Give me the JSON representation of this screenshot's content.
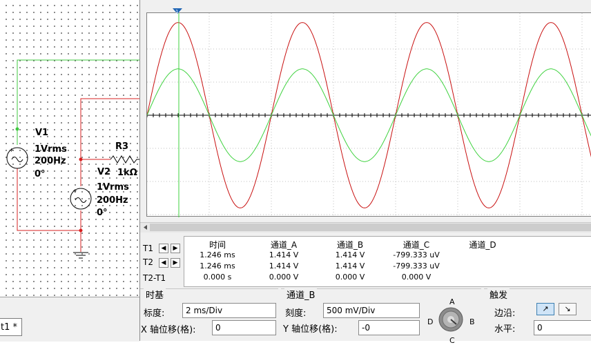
{
  "schematic": {
    "v1": {
      "name": "V1",
      "amplitude": "1Vrms",
      "frequency": "200Hz",
      "phase": "0°"
    },
    "v2": {
      "name": "V2",
      "amplitude": "1Vrms",
      "frequency": "200Hz",
      "phase": "0°"
    },
    "r3": {
      "name": "R3",
      "value": "1kΩ"
    },
    "sheet_tab": "t1 *",
    "colors": {
      "wire_a": "#3fc83f",
      "wire_b": "#d72020"
    }
  },
  "scope": {
    "trace_colors": {
      "channel_a": "#3fd23f",
      "channel_b": "#c80f0f",
      "cursor": "#3fd23f",
      "cursor_marker": "#1e64b4"
    },
    "readout": {
      "headers": {
        "time": "时间",
        "ch_a": "通道_A",
        "ch_b": "通道_B",
        "ch_c": "通道_C",
        "ch_d": "通道_D"
      },
      "rows": [
        {
          "label": "T1",
          "time": "1.246 ms",
          "ch_a": "1.414 V",
          "ch_b": "1.414 V",
          "ch_c": "-799.333 uV"
        },
        {
          "label": "T2",
          "time": "1.246 ms",
          "ch_a": "1.414 V",
          "ch_b": "1.414 V",
          "ch_c": "-799.333 uV"
        },
        {
          "label": "T2-T1",
          "time": "0.000 s",
          "ch_a": "0.000 V",
          "ch_b": "0.000 V",
          "ch_c": "0.000 V"
        }
      ]
    },
    "timebase": {
      "title": "时基",
      "scale_label": "标度:",
      "scale_value": "2 ms/Div",
      "xpos_label": "X 轴位移(格):",
      "xpos_value": "0"
    },
    "channel_b": {
      "title": "通道_B",
      "scale_label": "刻度:",
      "scale_value": "500 mV/Div",
      "ypos_label": "Y 轴位移(格):",
      "ypos_value": "-0",
      "knob_labels": {
        "a": "A",
        "b": "B",
        "c": "C",
        "d": "D"
      }
    },
    "trigger": {
      "title": "触发",
      "edge_label": "边沿:",
      "edge_rising": "↗",
      "edge_falling": "↘",
      "level_label": "水平:",
      "level_value": "0"
    }
  }
}
